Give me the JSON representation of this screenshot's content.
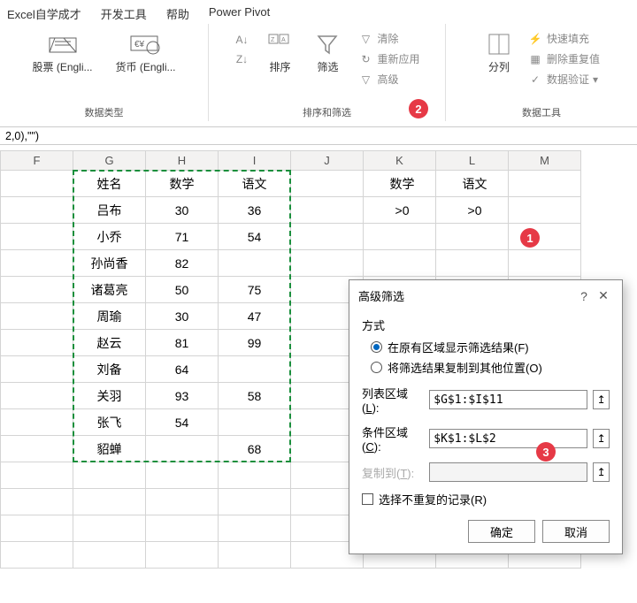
{
  "tabs": [
    "Excel自学成才",
    "开发工具",
    "帮助",
    "Power Pivot"
  ],
  "ribbon": {
    "group1": {
      "label": "数据类型",
      "stocks": "股票 (Engli...",
      "currency": "货币 (Engli..."
    },
    "group2": {
      "label": "排序和筛选",
      "sort": "排序",
      "filter": "筛选",
      "clear": "清除",
      "reapply": "重新应用",
      "advanced": "高级"
    },
    "group3": {
      "label": "数据工具",
      "split": "分列",
      "flashfill": "快速填充",
      "dedup": "删除重复值",
      "validate": "数据验证"
    }
  },
  "formula": "2,0),\"\")",
  "cols": [
    "F",
    "G",
    "H",
    "I",
    "J",
    "K",
    "L",
    "M"
  ],
  "table": {
    "headers": [
      "姓名",
      "数学",
      "语文"
    ],
    "rows": [
      [
        "吕布",
        "30",
        "36"
      ],
      [
        "小乔",
        "71",
        "54"
      ],
      [
        "孙尚香",
        "82",
        ""
      ],
      [
        "诸葛亮",
        "50",
        "75"
      ],
      [
        "周瑜",
        "30",
        "47"
      ],
      [
        "赵云",
        "81",
        "99"
      ],
      [
        "刘备",
        "64",
        ""
      ],
      [
        "关羽",
        "93",
        "58"
      ],
      [
        "张飞",
        "54",
        ""
      ],
      [
        "貂蝉",
        "",
        "68"
      ]
    ]
  },
  "criteria": {
    "headers": [
      "数学",
      "语文"
    ],
    "row": [
      ">0",
      ">0"
    ]
  },
  "dialog": {
    "title": "高级筛选",
    "method_label": "方式",
    "opt_inplace": "在原有区域显示筛选结果(F)",
    "opt_copy": "将筛选结果复制到其他位置(O)",
    "list_label_a": "列表区域(",
    "list_label_u": "L",
    "list_label_b": "):",
    "list_value": "$G$1:$I$11",
    "crit_label_a": "条件区域(",
    "crit_label_u": "C",
    "crit_label_b": "):",
    "crit_value": "$K$1:$L$2",
    "copy_label_a": "复制到(",
    "copy_label_u": "T",
    "copy_label_b": "):",
    "copy_value": "",
    "unique_label": "选择不重复的记录(R)",
    "ok": "确定",
    "cancel": "取消"
  },
  "badges": {
    "b1": "1",
    "b2": "2",
    "b3": "3"
  }
}
